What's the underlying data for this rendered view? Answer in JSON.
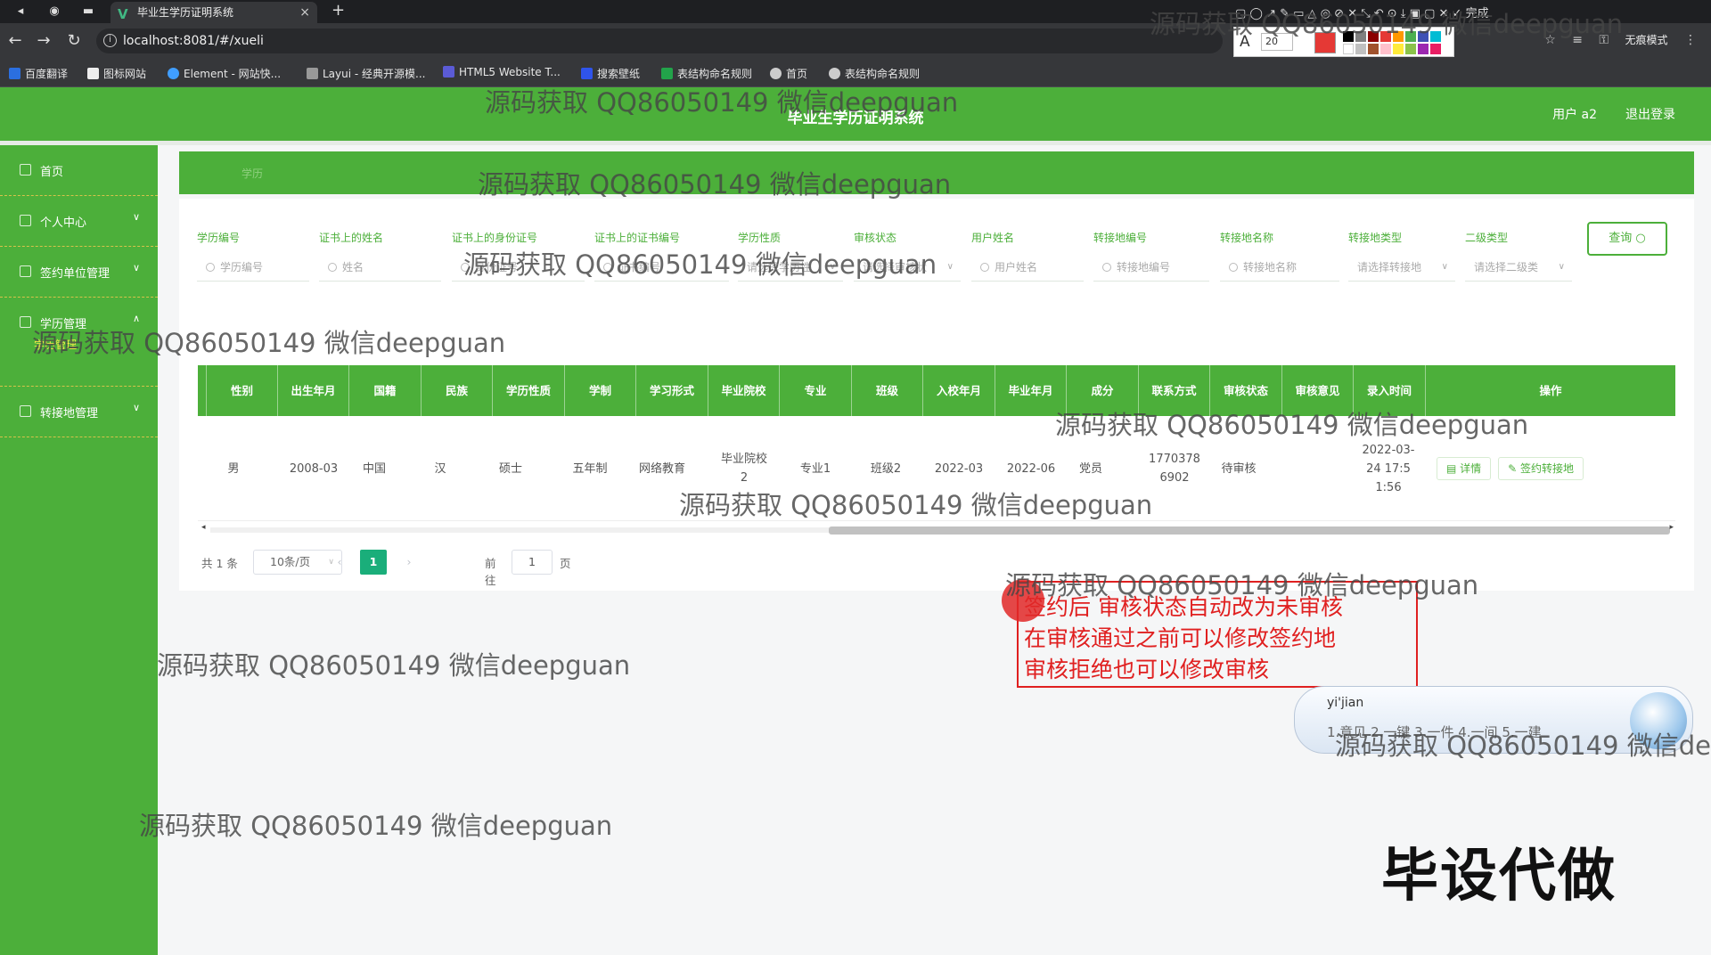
{
  "browser": {
    "tab_title": "毕业生学历证明系统",
    "url": "localhost:8081/#/xueli",
    "incognito_label": "无痕模式",
    "done_label": "完成",
    "bookmarks": [
      "百度翻译",
      "图标网站",
      "Element - 网站快...",
      "Layui - 经典开源模...",
      "HTML5 Website T...",
      "搜索壁纸",
      "表结构命名规则",
      "首页",
      "表结构命名规则"
    ],
    "font_size_value": "20"
  },
  "header": {
    "title": "毕业生学历证明系统",
    "user": "用户 a2",
    "logout": "退出登录"
  },
  "sidebar": {
    "items": [
      {
        "label": "首页"
      },
      {
        "label": "个人中心"
      },
      {
        "label": "签约单位管理"
      },
      {
        "label": "学历管理",
        "sub": "学历管理"
      },
      {
        "label": "转接地管理"
      }
    ]
  },
  "banner": {
    "breadcrumb": "学历"
  },
  "filters": [
    {
      "label": "学历编号",
      "placeholder": "学历编号"
    },
    {
      "label": "证书上的姓名",
      "placeholder": "姓名"
    },
    {
      "label": "证书上的身份证号",
      "placeholder": "身份证号"
    },
    {
      "label": "证书上的证书编号",
      "placeholder": "证书编号"
    },
    {
      "label": "学历性质",
      "placeholder": "请选择学历性"
    },
    {
      "label": "审核状态",
      "placeholder": "请选择审核状"
    },
    {
      "label": "用户姓名",
      "placeholder": "用户姓名"
    },
    {
      "label": "转接地编号",
      "placeholder": "转接地编号"
    },
    {
      "label": "转接地名称",
      "placeholder": "转接地名称"
    },
    {
      "label": "转接地类型",
      "placeholder": "请选择转接地"
    },
    {
      "label": "二级类型",
      "placeholder": "请选择二级类"
    }
  ],
  "query_button": "查询",
  "table": {
    "columns": [
      "性别",
      "出生年月",
      "国籍",
      "民族",
      "学历性质",
      "学制",
      "学习形式",
      "毕业院校",
      "专业",
      "班级",
      "入校年月",
      "毕业年月",
      "成分",
      "联系方式",
      "审核状态",
      "审核意见",
      "录入时间",
      "操作"
    ],
    "rows": [
      {
        "gender": "男",
        "birth": "2008-03",
        "nationality": "中国",
        "ethnicity": "汉",
        "degree": "硕士",
        "duration": "五年制",
        "study_mode": "网络教育",
        "school": "毕业院校2",
        "major": "专业1",
        "class": "班级2",
        "enroll": "2022-03",
        "graduate": "2022-06",
        "composition": "党员",
        "phone": "17703786902",
        "review_status": "待审核",
        "review_opinion": "",
        "entry_time": "2022-03-24 17:51:56",
        "actions": [
          "详情",
          "签约转接地"
        ]
      }
    ]
  },
  "pagination": {
    "total": "共 1 条",
    "page_size": "10条/页",
    "current_page": "1",
    "goto_label": "前往",
    "goto_value": "1",
    "page_word": "页"
  },
  "annotation": {
    "lines": [
      "签约后 审核状态自动改为未审核",
      "在审核通过之前可以修改签约地",
      "审核拒绝也可以修改审核"
    ]
  },
  "ime": {
    "pinyin": "yi'jian",
    "candidates": "1.意见  2.一键  3.一件  4.一间  5.一建"
  },
  "promo": "毕设代做",
  "watermark": "源码获取 QQ86050149 微信deepguan"
}
